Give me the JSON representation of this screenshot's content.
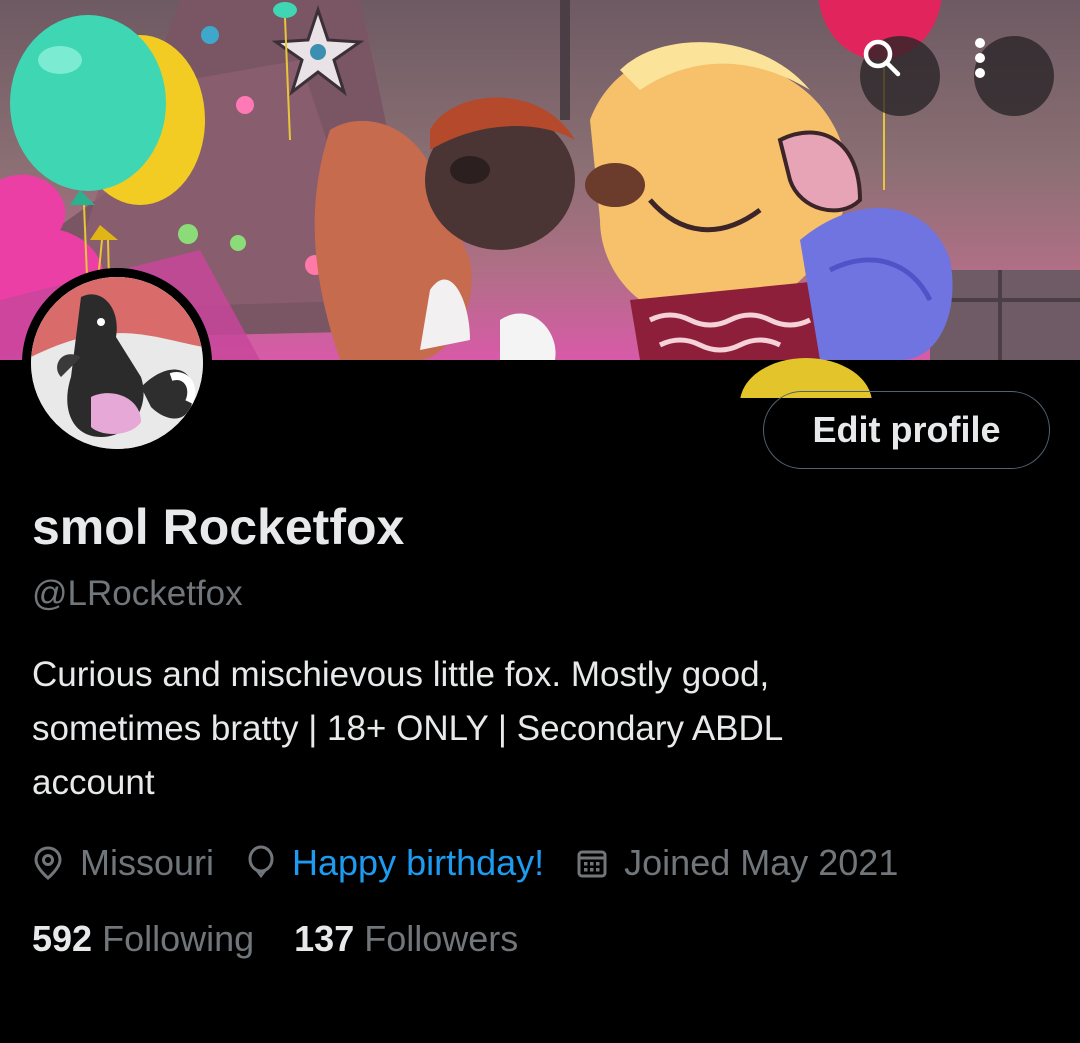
{
  "header": {
    "search_icon": "search-icon",
    "more_icon": "more-vertical-icon"
  },
  "profile": {
    "display_name": "smol Rocketfox",
    "handle": "@LRocketfox",
    "bio_lines": [
      "Curious and mischievous little fox. Mostly good,",
      "sometimes bratty | 18+ ONLY | Secondary ABDL",
      "account"
    ],
    "edit_button_label": "Edit profile"
  },
  "meta": {
    "location": "Missouri",
    "birthday": "Happy birthday!",
    "joined": "Joined May 2021"
  },
  "stats": {
    "following_count": "592",
    "following_label": "Following",
    "followers_count": "137",
    "followers_label": "Followers"
  },
  "colors": {
    "background": "#000000",
    "text_primary": "#e7e9ea",
    "text_secondary": "#71767b",
    "link": "#1d9bf0",
    "button_border": "#536471"
  }
}
